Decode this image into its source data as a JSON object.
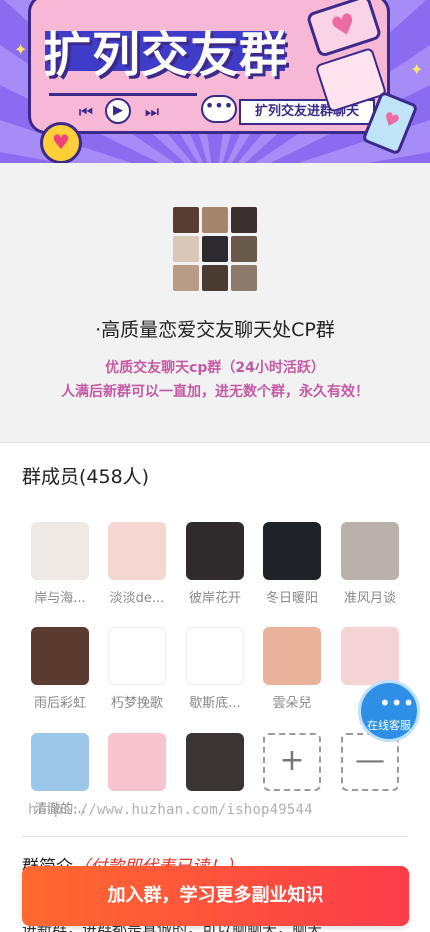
{
  "banner": {
    "title": "扩列交友群",
    "tag": "扩列交友进群聊天",
    "controls": {
      "prev": "⏮",
      "play": "▶",
      "next": "⏭"
    },
    "speech_glyph": "•••",
    "heart_glyph": "♥"
  },
  "group": {
    "name": "·高质量恋爱交友聊天处CP群",
    "desc_line1": "优质交友聊天cp群（24小时活跃）",
    "desc_line2": "人满后新群可以一直加，进无数个群，永久有效！",
    "grid_colors": [
      "#5a3d32",
      "#a4866e",
      "#3b3030",
      "#d9c7b7",
      "#2d2a2f",
      "#6a5a4c",
      "#b89c86",
      "#4a3b33",
      "#8c7a6a"
    ]
  },
  "members": {
    "title": "群成员(458人)",
    "items": [
      {
        "name": "岸与海...",
        "color": "#efe9e6",
        "glyph": ""
      },
      {
        "name": "淡淡de...",
        "color": "#f5d6d0",
        "glyph": ""
      },
      {
        "name": "彼岸花开",
        "color": "#2f2a2c",
        "glyph": ""
      },
      {
        "name": "冬日暖阳",
        "color": "#1f2328",
        "glyph": ""
      },
      {
        "name": "准风月谈",
        "color": "#b9b2aa",
        "glyph": ""
      },
      {
        "name": "雨后彩虹",
        "color": "#5b3a30",
        "glyph": ""
      },
      {
        "name": "朽梦挽歌",
        "color": "#ffffff",
        "glyph": ""
      },
      {
        "name": "歇斯底...",
        "color": "#ffffff",
        "glyph": ""
      },
      {
        "name": "雲朵兒",
        "color": "#e8b29b",
        "glyph": ""
      },
      {
        "name": "",
        "color": "#f6d4d6",
        "glyph": ""
      },
      {
        "name": "清澈的...",
        "color": "#9cc7e8",
        "glyph": ""
      },
      {
        "name": "",
        "color": "#f7c4cf",
        "glyph": ""
      },
      {
        "name": "",
        "color": "#3a3534",
        "glyph": ""
      }
    ],
    "add_glyph": "+",
    "remove_glyph": "—"
  },
  "service": {
    "label": "在线客服",
    "icon_glyph": "•••"
  },
  "watermark": "https://www.huzhan.com/ishop49544",
  "intro": {
    "label": "群简介",
    "accent": "（付款即代表已读！）",
    "text": "进新群，进群都是真诚的，可以聊聊天，聊天"
  },
  "join_button": "加入群，学习更多副业知识"
}
